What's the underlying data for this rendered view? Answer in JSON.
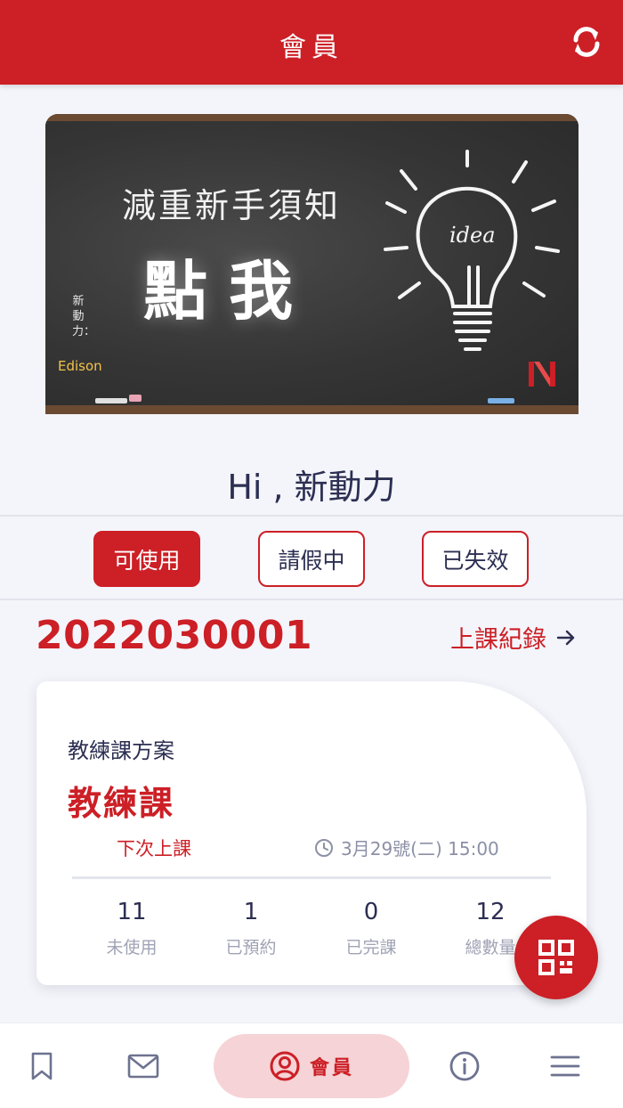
{
  "header": {
    "title": "會員",
    "refresh_icon": "refresh-icon"
  },
  "banner": {
    "headline": "減重新手須知",
    "click_text": "點我",
    "side_text": "新動力：",
    "brand": "Edison",
    "bulb_text": "idea"
  },
  "greeting": "Hi , 新動力",
  "status_tabs": [
    {
      "label": "可使用",
      "active": true
    },
    {
      "label": "請假中",
      "active": false
    },
    {
      "label": "已失效",
      "active": false
    }
  ],
  "member": {
    "id": "2022030001",
    "records_label": "上課紀錄"
  },
  "card": {
    "plan_name": "教練課方案",
    "course_name": "教練課",
    "next_label": "下次上課",
    "next_time": "3月29號(二) 15:00",
    "stats": [
      {
        "value": "11",
        "label": "未使用"
      },
      {
        "value": "1",
        "label": "已預約"
      },
      {
        "value": "0",
        "label": "已完課"
      },
      {
        "value": "12",
        "label": "總數量"
      }
    ]
  },
  "bottom_nav": {
    "items": [
      "bookmark-icon",
      "mail-icon",
      "user-circle-icon",
      "info-icon",
      "menu-icon"
    ],
    "active_label": "會員"
  },
  "colors": {
    "brand": "#cc1f26",
    "text": "#2c2f52",
    "background": "#f4f5fa"
  }
}
